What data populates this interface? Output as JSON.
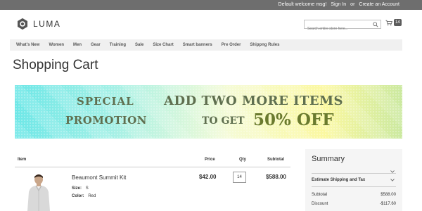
{
  "topbar": {
    "welcome": "Default welcome msg!",
    "sign_in": "Sign In",
    "or": "or",
    "create_account": "Create an Account"
  },
  "header": {
    "logo_text": "LUMA",
    "search_placeholder": "Search entire store here...",
    "cart_count": "14"
  },
  "nav": {
    "items": [
      "What's New",
      "Women",
      "Men",
      "Gear",
      "Training",
      "Sale",
      "Size Chart",
      "Smart banners",
      "Pre Order",
      "Shippng Rules"
    ]
  },
  "page_title": "Shopping Cart",
  "banner": {
    "line1": "SPECIAL",
    "line2": "PROMOTION",
    "line3": "ADD TWO MORE ITEMS",
    "line4": "TO GET",
    "line5": "50% OFF"
  },
  "cart_table": {
    "headers": {
      "item": "Item",
      "price": "Price",
      "qty": "Qty",
      "subtotal": "Subtotal"
    },
    "product": {
      "name": "Beaumont Summit Kit",
      "size_label": "Size:",
      "size_value": "S",
      "color_label": "Color:",
      "color_value": "Red",
      "price": "$42.00",
      "qty": "14",
      "subtotal": "$588.00"
    }
  },
  "summary": {
    "title": "Summary",
    "shipping_label": "Estimate Shipping and Tax",
    "subtotal_label": "Subtotal",
    "subtotal_value": "$588.00",
    "discount_label": "Discount",
    "discount_value": "-$117.60"
  }
}
